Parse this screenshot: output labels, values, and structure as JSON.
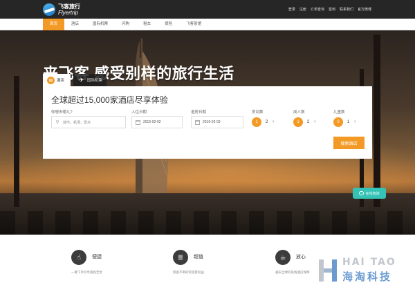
{
  "header": {
    "logo_cn": "飞客旅行",
    "logo_en": "Flyertrip",
    "links": [
      "登录",
      "注册",
      "订单查询",
      "签到",
      "联系我们",
      "官方微博"
    ]
  },
  "nav": {
    "items": [
      "首页",
      "酒店",
      "国际机票",
      "闪购",
      "租车",
      "保险",
      "飞客茶馆"
    ],
    "active_index": 0
  },
  "hero": {
    "headline": "来飞客 感受别样的旅行生活"
  },
  "tabs": {
    "hotel": "酒店",
    "flight": "国际机票",
    "active": "hotel"
  },
  "search": {
    "title": "全球超过15,000家酒店尽享体验",
    "destination_label": "你想去哪儿?",
    "destination_placeholder": "城市，机场，景点",
    "checkin_label": "入住日期",
    "checkin_value": "2016-02-02",
    "checkout_label": "退房日期",
    "checkout_value": "2016-02-03",
    "rooms_label": "房间数",
    "rooms_value": "2",
    "adults_label": "成人数",
    "adults_value": "2",
    "children_label": "儿童数",
    "children_value": "1",
    "minus": "1",
    "adults_minus": "1",
    "children_minus": "0",
    "plus": "+",
    "submit_label": "搜索酒店"
  },
  "consult": {
    "label": "在线咨询"
  },
  "features": [
    {
      "title": "便捷",
      "desc": "一键下单尽享旅程无忧",
      "icon": "hand-pointer-icon"
    },
    {
      "title": "超值",
      "desc": "惊喜不断的常旅客权益",
      "icon": "coins-icon"
    },
    {
      "title": "放心",
      "desc": "遍布全球的航线酒店保障",
      "icon": "coffee-cup-icon"
    }
  ],
  "watermark": {
    "top": "HAI TAO",
    "bottom": "海淘科技"
  },
  "colors": {
    "accent": "#f39a26",
    "topbar": "#262626",
    "consult": "#34c3b5"
  }
}
